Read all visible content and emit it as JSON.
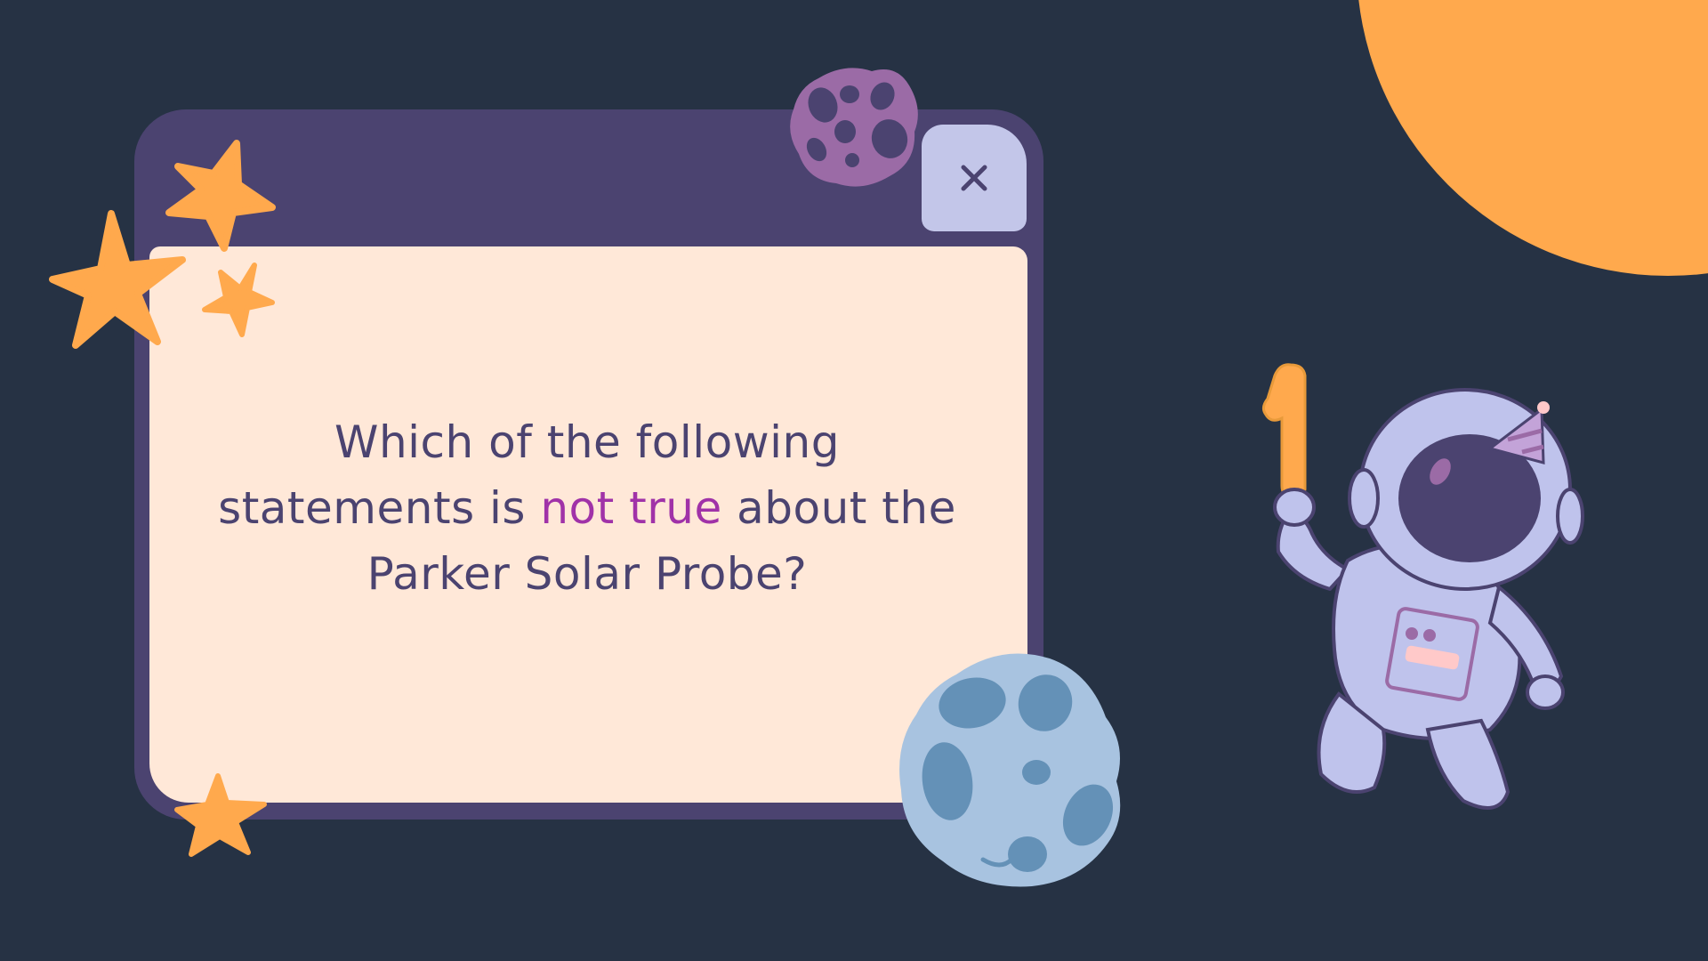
{
  "question": {
    "line1": "Which of the following",
    "line2_before": "statements is ",
    "line2_highlight": "not true",
    "line2_after": " about the",
    "line3": "Parker Solar Probe?"
  },
  "close_button": {
    "icon": "close-icon",
    "glyph": "×"
  },
  "balloon_number": "1",
  "colors": {
    "background": "#263244",
    "window_frame": "#4B4370",
    "content_panel": "#FFE8D8",
    "close_button": "#C3C6E9",
    "accent_orange": "#FFA94D",
    "highlight_text": "#A032A8",
    "asteroid_purple": "#9B6BA6",
    "asteroid_blue": "#A8C3E0",
    "astronaut_suit": "#BFC3EC"
  }
}
